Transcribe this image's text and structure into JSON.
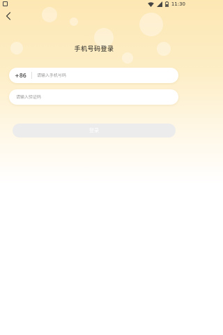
{
  "status_bar": {
    "time": "11:30"
  },
  "icons": {
    "back": "chevron-left-icon",
    "wifi": "wifi-icon",
    "signal": "signal-icon",
    "battery": "battery-icon",
    "notification": "notification-icon"
  },
  "header": {
    "title": "手机号码登录"
  },
  "phone": {
    "country_code": "+86",
    "placeholder": "请输入手机号码",
    "value": ""
  },
  "code": {
    "placeholder": "请输入验证码",
    "value": ""
  },
  "login": {
    "label": "登录"
  },
  "colors": {
    "background_top": "#fde7b3",
    "background_bottom": "#ffffff",
    "button_disabled": "#ececec"
  }
}
